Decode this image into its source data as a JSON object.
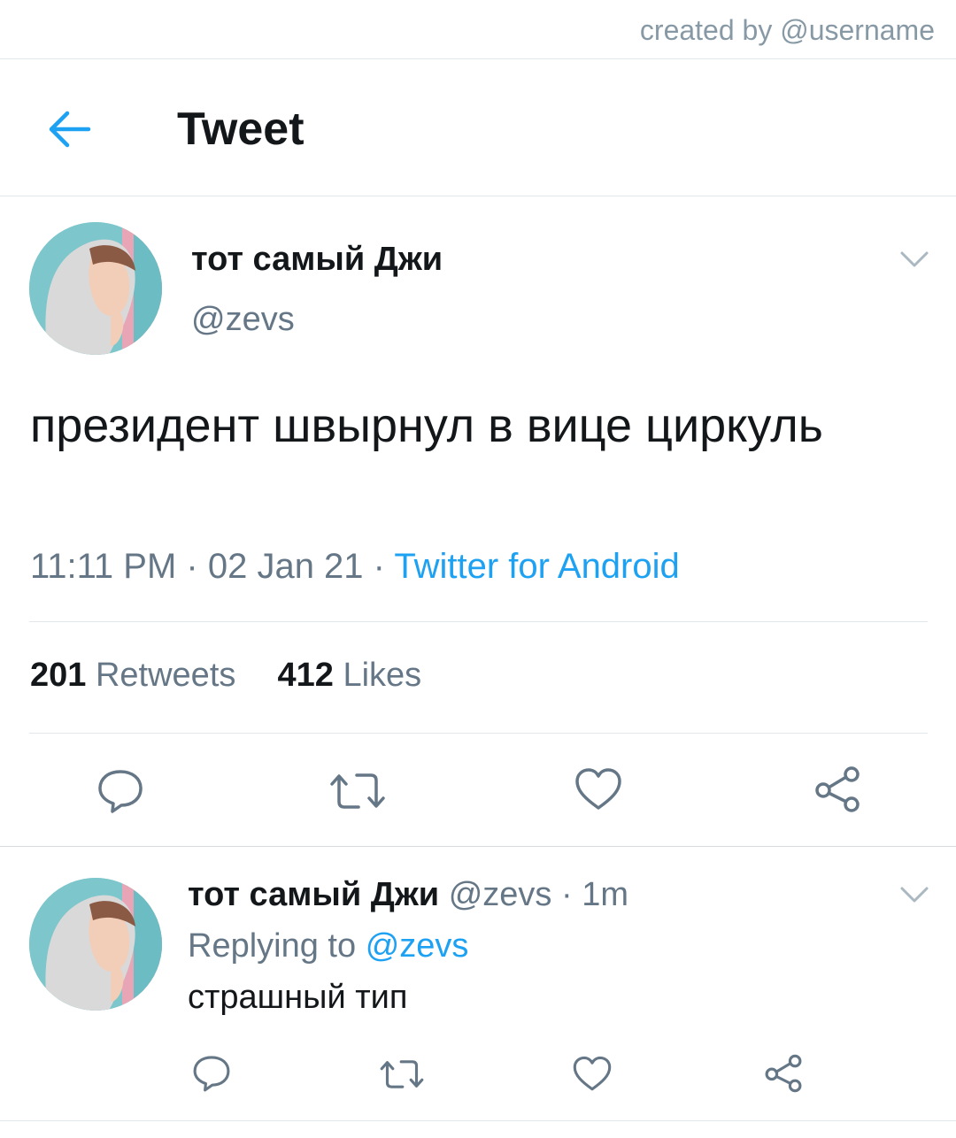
{
  "credit": "created by @username",
  "header": {
    "title": "Tweet"
  },
  "tweet": {
    "author_name": "тот самый Джи",
    "author_handle": "@zevs",
    "text": "президент швырнул в вице циркуль",
    "time": "11:11 PM",
    "date": "02 Jan 21",
    "source": "Twitter for Android",
    "retweets_count": "201",
    "retweets_label": "Retweets",
    "likes_count": "412",
    "likes_label": "Likes"
  },
  "reply": {
    "author_name": "тот самый Джи",
    "author_handle": "@zevs",
    "age": "1m",
    "replying_to_label": "Replying to",
    "replying_to_handle": "@zevs",
    "text": "страшный тип"
  },
  "icons": {
    "back": "arrow-left-icon",
    "more": "chevron-down-icon",
    "reply": "comment-icon",
    "retweet": "retweet-icon",
    "like": "heart-icon",
    "share": "share-icon"
  },
  "colors": {
    "accent": "#1da1f2",
    "text": "#14171a",
    "secondary": "#657786",
    "divider": "#e1e8ed"
  }
}
